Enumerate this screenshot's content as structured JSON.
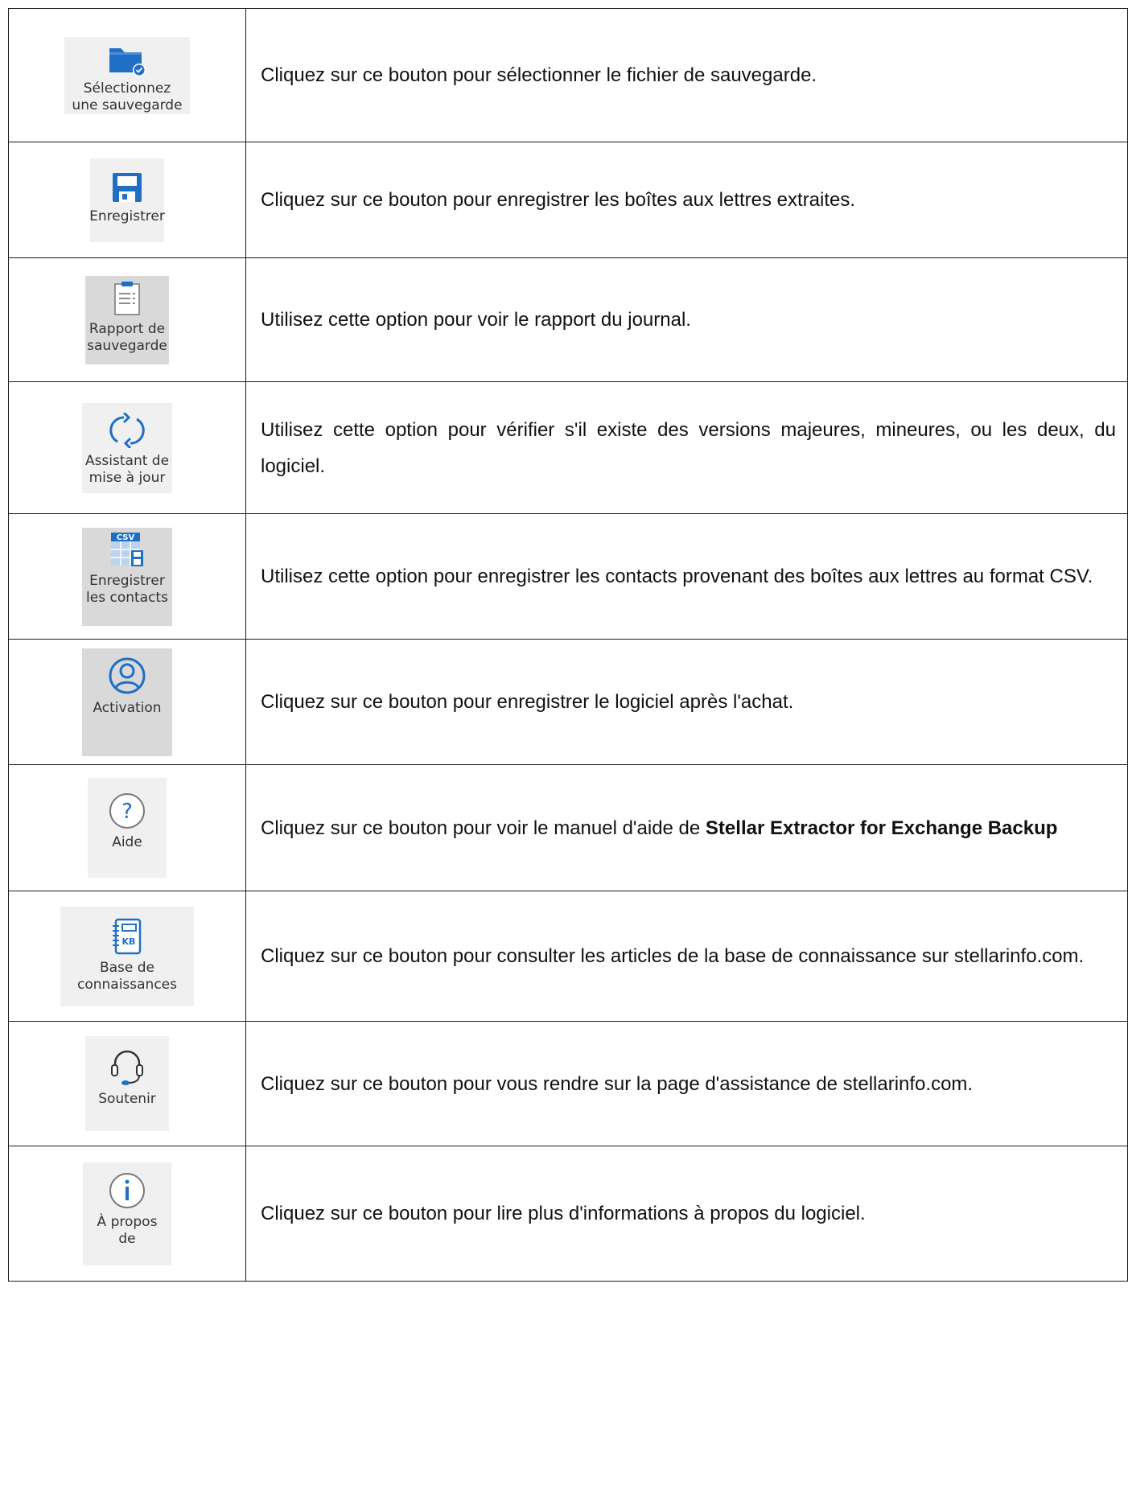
{
  "colors": {
    "icon_blue": "#1f6fc4",
    "tile_light": "#f0f0f0",
    "tile_dark": "#d9d9d9",
    "border": "#1a1a1a"
  },
  "rows": [
    {
      "icon": "folder-check-icon",
      "label": "Sélectionnez\nune sauvegarde",
      "description": "Cliquez sur ce bouton pour sélectionner le fichier de sauvegarde."
    },
    {
      "icon": "floppy-disk-icon",
      "label": "Enregistrer",
      "description": "Cliquez sur ce bouton pour enregistrer les boîtes aux lettres extraites."
    },
    {
      "icon": "clipboard-report-icon",
      "label": "Rapport de\nsauvegarde",
      "description": "Utilisez cette option pour voir le rapport du journal."
    },
    {
      "icon": "refresh-arrows-icon",
      "label": "Assistant de\nmise à jour",
      "description": "Utilisez cette option pour vérifier s'il existe des versions majeures, mineures, ou les deux, du logiciel."
    },
    {
      "icon": "csv-file-icon",
      "label": "Enregistrer\nles contacts",
      "description": "Utilisez cette option pour enregistrer les contacts provenant des boîtes aux lettres au format CSV."
    },
    {
      "icon": "user-circle-icon",
      "label": "Activation",
      "description": "Cliquez sur ce bouton pour enregistrer le logiciel après l'achat."
    },
    {
      "icon": "question-circle-icon",
      "label": "Aide",
      "description_prefix": "Cliquez sur ce bouton pour voir le manuel d'aide de ",
      "description_bold": "Stellar Extractor for Exchange Backup"
    },
    {
      "icon": "knowledge-base-icon",
      "label": "Base de\nconnaissances",
      "description": "Cliquez sur ce bouton pour consulter les articles de la base de connaissance sur stellarinfo.com."
    },
    {
      "icon": "headset-icon",
      "label": "Soutenir",
      "description": "Cliquez sur ce bouton pour vous rendre sur la page d'assistance de stellarinfo.com."
    },
    {
      "icon": "info-circle-icon",
      "label": "À propos\nde",
      "description": "Cliquez sur ce bouton pour lire plus d'informations à propos du logiciel."
    }
  ]
}
